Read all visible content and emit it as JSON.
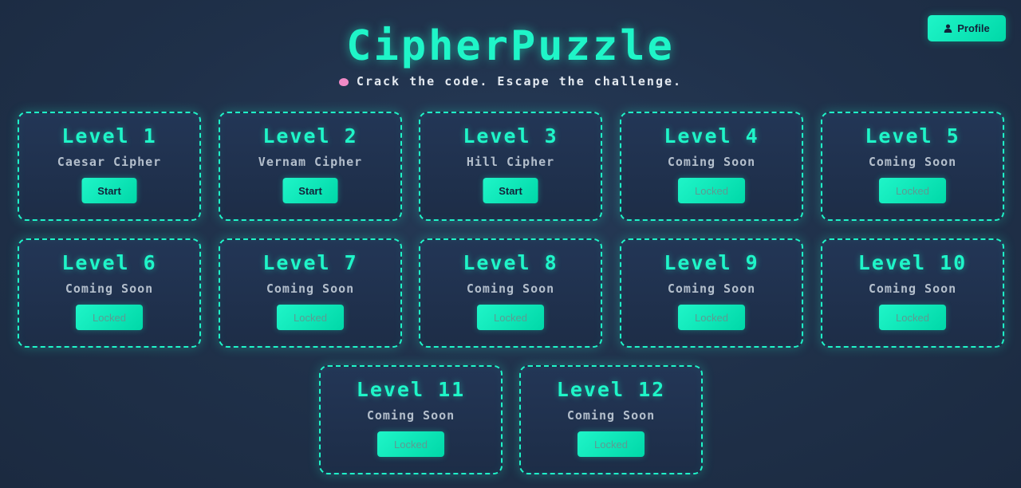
{
  "header": {
    "title": "CipherPuzzle",
    "subtitle": "Crack the code. Escape the challenge."
  },
  "profile": {
    "label": "Profile",
    "icon": "user-icon"
  },
  "levels": [
    {
      "level": "Level 1",
      "name": "Caesar Cipher",
      "button": "Start",
      "state": "unlocked"
    },
    {
      "level": "Level 2",
      "name": "Vernam Cipher",
      "button": "Start",
      "state": "unlocked"
    },
    {
      "level": "Level 3",
      "name": "Hill Cipher",
      "button": "Start",
      "state": "unlocked"
    },
    {
      "level": "Level 4",
      "name": "Coming Soon",
      "button": "Locked",
      "state": "locked"
    },
    {
      "level": "Level 5",
      "name": "Coming Soon",
      "button": "Locked",
      "state": "locked"
    },
    {
      "level": "Level 6",
      "name": "Coming Soon",
      "button": "Locked",
      "state": "locked"
    },
    {
      "level": "Level 7",
      "name": "Coming Soon",
      "button": "Locked",
      "state": "locked"
    },
    {
      "level": "Level 8",
      "name": "Coming Soon",
      "button": "Locked",
      "state": "locked"
    },
    {
      "level": "Level 9",
      "name": "Coming Soon",
      "button": "Locked",
      "state": "locked"
    },
    {
      "level": "Level 10",
      "name": "Coming Soon",
      "button": "Locked",
      "state": "locked"
    },
    {
      "level": "Level 11",
      "name": "Coming Soon",
      "button": "Locked",
      "state": "locked"
    },
    {
      "level": "Level 12",
      "name": "Coming Soon",
      "button": "Locked",
      "state": "locked"
    }
  ],
  "colors": {
    "accent": "#1ff5c8",
    "background": "#1f3049",
    "brain": "#f08ac6"
  }
}
